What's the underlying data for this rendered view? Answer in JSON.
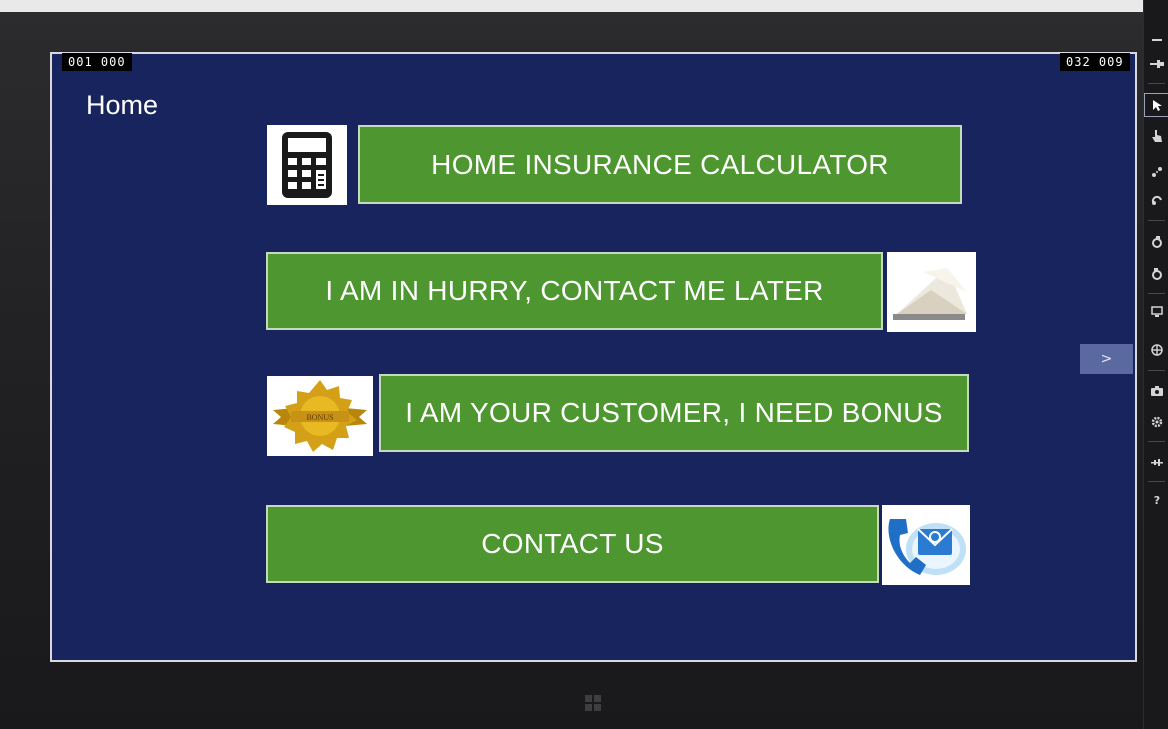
{
  "coords": {
    "left": "001  000",
    "right": "032  009"
  },
  "page": {
    "title": "Home"
  },
  "tiles": {
    "calculator": "HOME INSURANCE CALCULATOR",
    "hurry": "I AM IN HURRY, CONTACT ME LATER",
    "bonus": "I AM YOUR CUSTOMER, I NEED BONUS",
    "contact": "CONTACT US"
  },
  "seal_text": "BONUS",
  "expander_glyph": ">",
  "toolbar_icons": [
    "minimize-icon",
    "pin-icon",
    "pointer-icon",
    "touch-icon",
    "pinch-icon",
    "rotate-touch-icon",
    "rotate-clockwise-icon",
    "rotate-counterclockwise-icon",
    "resolution-icon",
    "location-icon",
    "screenshot-icon",
    "settings-icon",
    "network-icon",
    "help-icon"
  ],
  "colors": {
    "screen_bg": "#17245e",
    "tile_green": "#4e962f",
    "tile_border": "#c7d9bc"
  }
}
